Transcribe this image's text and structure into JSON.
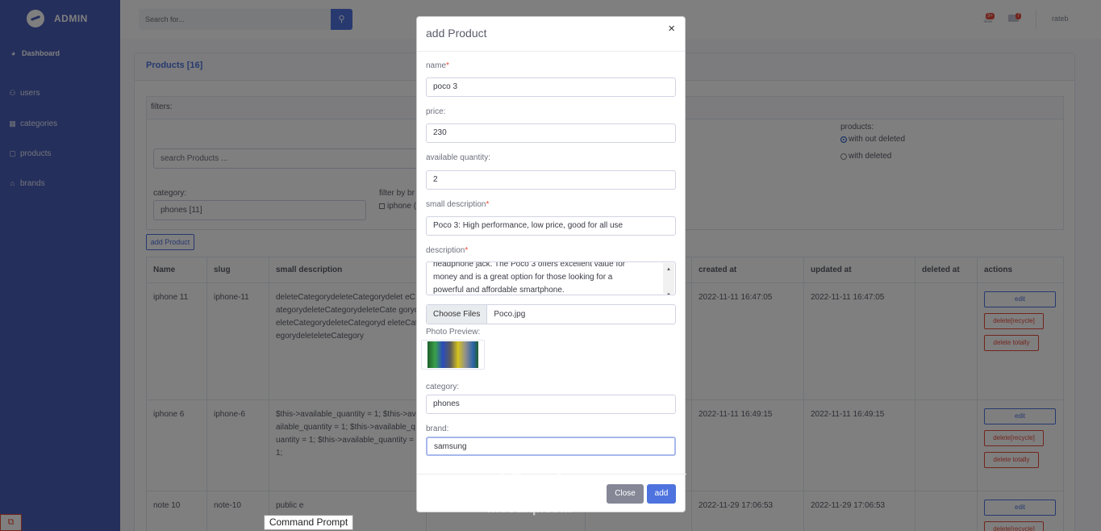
{
  "sidebar": {
    "brand": "ADMIN",
    "dashboard": "Dashboard",
    "items": [
      "users",
      "categories",
      "products",
      "brands"
    ]
  },
  "topbar": {
    "search_placeholder": "Search for...",
    "alerts_badge": "3+",
    "messages_badge": "7",
    "user": "rateb"
  },
  "products": {
    "title": "Products [16]",
    "filters_label": "filters:",
    "search_placeholder": "search Products ...",
    "category_label": "category:",
    "category_value": "phones [11]",
    "brand_filter_label": "filter by br",
    "brand_filter_option": "iphone (",
    "products_label": "products:",
    "radio_without": "with out deleted",
    "radio_with": "with deleted",
    "add_button": "add Product",
    "columns": [
      "Name",
      "slug",
      "small description",
      "",
      "",
      "created at",
      "updated at",
      "deleted at",
      "actions"
    ],
    "rows": [
      {
        "name": "iphone 11",
        "slug": "iphone-11",
        "desc": "deleteCategorydeleteCategorydelet eCategorydeleteCategorydeleteCate gorydeleteCategorydeleteCategoryd eleteCategorydeleteleteCategory",
        "created": "2022-11-11 16:47:05",
        "updated": "2022-11-11 16:47:05"
      },
      {
        "name": "iphone 6",
        "slug": "iphone-6",
        "desc": "$this->available_quantity = 1; $this->available_quantity = 1; $this->available_quantity = 1; $this->available_quantity = 1;",
        "created": "2022-11-11 16:49:15",
        "updated": "2022-11-11 16:49:15"
      },
      {
        "name": "note 10",
        "slug": "note-10",
        "desc": "public e",
        "created": "2022-11-29 17:06:53",
        "updated": "2022-11-29 17:06:53"
      }
    ],
    "actions": {
      "edit": "edit",
      "recycle": "delete[recycle]",
      "totally": "delete totally"
    }
  },
  "modal": {
    "title": "add Product",
    "name_label": "name",
    "name_value": "poco 3",
    "price_label": "price:",
    "price_value": "230",
    "qty_label": "available quantity:",
    "qty_value": "2",
    "small_desc_label": "small description",
    "small_desc_value": "Poco 3: High performance, low price, good for all use",
    "desc_label": "description",
    "desc_line1": "headphone jack. The Poco 3 offers excellent value for",
    "desc_line2": "money and is a great option for those looking for a",
    "desc_line3": "powerful and affordable smartphone.",
    "file_button": "Choose Files",
    "file_name": "Poco.jpg",
    "preview_label": "Photo Preview:",
    "category_label": "category:",
    "category_value": "phones",
    "brand_label": "brand:",
    "brand_value": "samsung",
    "close_button": "Close",
    "add_button": "add"
  },
  "tooltip": "Command Prompt",
  "watermark": "مستقل",
  "watermark_sub": "mostaql.com"
}
